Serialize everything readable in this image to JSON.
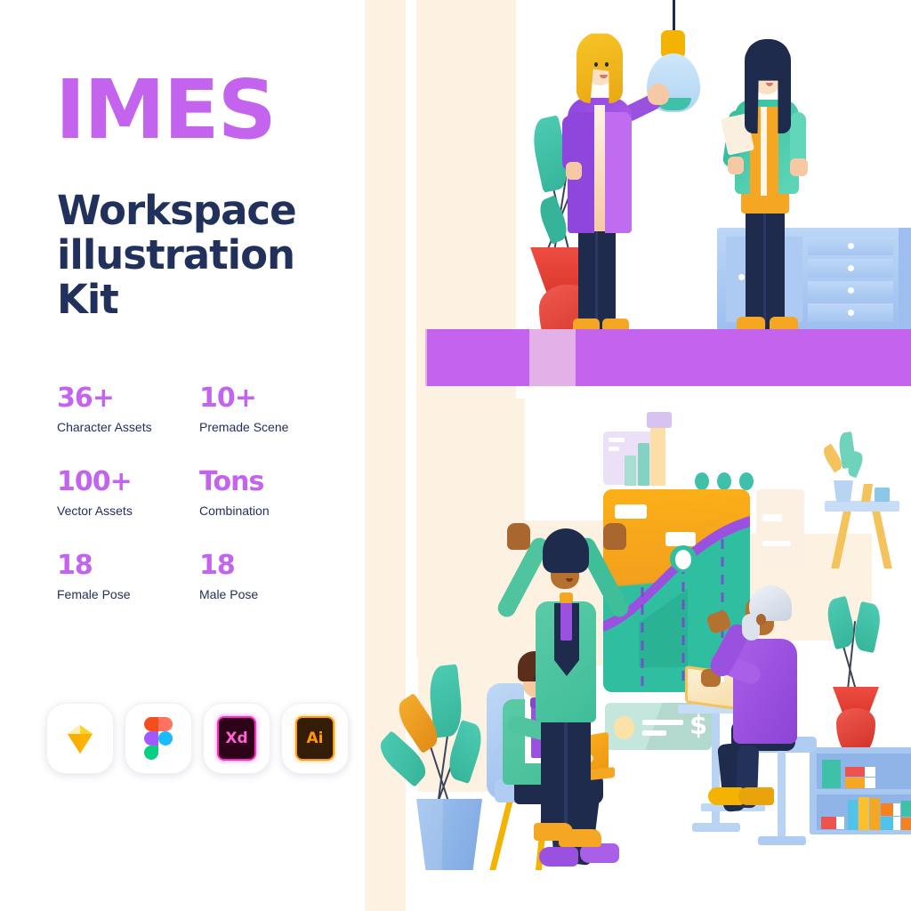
{
  "brand": {
    "title": "IMES",
    "subtitle_line1": "Workspace",
    "subtitle_line2": "illustration Kit",
    "accent_color": "#C463EE",
    "text_color": "#22305C"
  },
  "stats": [
    {
      "value": "36+",
      "label": "Character Assets"
    },
    {
      "value": "10+",
      "label": "Premade Scene"
    },
    {
      "value": "100+",
      "label": "Vector Assets"
    },
    {
      "value": "Tons",
      "label": "Combination"
    },
    {
      "value": "18",
      "label": "Female Pose"
    },
    {
      "value": "18",
      "label": "Male Pose"
    }
  ],
  "app_icons": [
    {
      "name": "sketch-icon",
      "label": "",
      "color": "#FDB300"
    },
    {
      "name": "figma-icon",
      "label": "",
      "color": "#A259FF"
    },
    {
      "name": "adobe-xd-icon",
      "label": "Xd",
      "color": "#FF2BC2"
    },
    {
      "name": "adobe-illustrator-icon",
      "label": "Ai",
      "color": "#FF9A00"
    }
  ],
  "illustration": {
    "top_scene": {
      "name": "office-meeting-scene",
      "characters": [
        {
          "name": "woman-hijab-presenting",
          "hijab_color": "#F5B301",
          "coat_color": "#9B51E0",
          "pants_color": "#1F2B4D",
          "shoes_color": "#F5A623"
        },
        {
          "name": "woman-with-tablet",
          "hair_color": "#1F2B4D",
          "cardigan_color": "#3FC1A9",
          "top_color": "#F5A623",
          "pants_color": "#1F2B4D"
        }
      ],
      "props": [
        {
          "name": "pendant-lamp",
          "shade_color": "#BBDDF5",
          "cap_color": "#F5B301",
          "ring_color": "#3FC1A9"
        },
        {
          "name": "red-vase-plant",
          "vase_color": "#E8392F",
          "leaf_color": "#3FC1A9"
        },
        {
          "name": "blue-cabinet",
          "body_color": "#A9C8F0",
          "drawer_count": "4",
          "legs_color": "#F5A623"
        },
        {
          "name": "purple-floor-bar",
          "color": "#C463EE"
        }
      ]
    },
    "bottom_scene": {
      "name": "workspace-presentation-scene",
      "characters": [
        {
          "name": "presenter-arms-raised",
          "hair_color": "#1F2B4D",
          "jacket_color": "#3FC1A9",
          "tie_color": "#9B51E0",
          "shoes_color": "#9B51E0"
        },
        {
          "name": "seated-man-laptop",
          "hair_color": "#5B2D1B",
          "jacket_color": "#4FC4A1",
          "tie_color": "#9B51E0",
          "laptop_color": "#F5A623",
          "chair_color": "#A9C8F0"
        },
        {
          "name": "elderly-man-standing-desk",
          "hair_color": "#E2E6EE",
          "sweater_color": "#9B51E0",
          "pants_color": "#1F2B4D",
          "shoes_color": "#F5B301",
          "stool_color": "#A9C8F0"
        }
      ],
      "props": [
        {
          "name": "growth-chart-board",
          "top_color": "#F5A623",
          "bottom_color": "#2FBFA0",
          "curve_color": "#9B51E0"
        },
        {
          "name": "money-check-card",
          "color": "#BFE6DC",
          "symbol": "$"
        },
        {
          "name": "bar-chart-widget",
          "color": "#E7D9F5"
        },
        {
          "name": "wall-shelf",
          "color": "#C7DCF7",
          "legs_color": "#F5C35C"
        },
        {
          "name": "bookshelf",
          "color": "#A9C8F0",
          "shelf_count": "2"
        },
        {
          "name": "red-vase-plant",
          "vase_color": "#E8392F",
          "leaf_color": "#3FC1A9"
        },
        {
          "name": "potted-plant-left",
          "pot_color": "#8FB5E8",
          "leaf_color": "#3FC1A9",
          "accent_leaf_color": "#F5A623"
        },
        {
          "name": "teal-dots",
          "color": "#3FC1A9",
          "count": "3"
        }
      ]
    },
    "background_bands": {
      "color": "#FDF1E1",
      "count": "5"
    }
  }
}
